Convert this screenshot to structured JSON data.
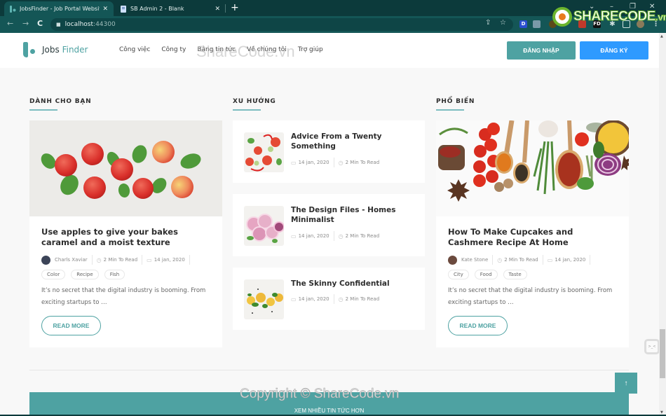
{
  "browser": {
    "tabs": [
      {
        "title": "JobsFinder - Job Portal Website T",
        "active": true,
        "icon": "jobsfinder-favicon"
      },
      {
        "title": "SB Admin 2 - Blank",
        "active": false,
        "icon": "document-favicon"
      }
    ],
    "new_tab": "+",
    "close": "✕",
    "url_host": "localhost",
    "url_port": ":44300",
    "window_controls": {
      "dropdown": "⌄",
      "minimize": "–",
      "maximize": "❐",
      "close": "✕"
    },
    "nav": {
      "back": "←",
      "forward": "→",
      "reload": "C"
    },
    "omnibox_icons": {
      "share": "⇪",
      "star": "☆"
    },
    "extensions": [
      "D",
      "",
      "",
      "",
      "FD",
      "",
      "",
      ""
    ],
    "menu": "⋮"
  },
  "watermark": {
    "brand": "SHARECODE",
    "tld": ".vn",
    "header_text": "ShareCode.vn",
    "copyright": "Copyright © ShareCode.vn"
  },
  "header": {
    "logo_text_1": "Jobs",
    "logo_text_2": "Finder",
    "nav": [
      "Công việc",
      "Công ty",
      "Bảng tin tức",
      "Về chúng tôi",
      "Trợ giúp"
    ],
    "login_label": "ĐĂNG NHẬP",
    "register_label": "ĐĂNG KÝ"
  },
  "sections": {
    "for_you": {
      "title": "DÀNH CHO BẠN",
      "card": {
        "image": "apples-image",
        "title": "Use apples to give your bakes caramel and a moist texture",
        "author": "Charls Xaviar",
        "read_time": "2 Min To Read",
        "date": "14 jan, 2020",
        "tags": [
          "Color",
          "Recipe",
          "Fish"
        ],
        "excerpt": "It’s no secret that the digital industry is booming. From exciting startups to …",
        "read_more": "READ MORE"
      }
    },
    "trending": {
      "title": "XU HƯỚNG",
      "items": [
        {
          "image": "tomato-salad-thumbnail",
          "title": "Advice From a Twenty Something",
          "date": "14 jan, 2020",
          "read_time": "2 Min To Read"
        },
        {
          "image": "onion-slices-thumbnail",
          "title": "The Design Files - Homes Minimalist",
          "date": "14 jan, 2020",
          "read_time": "2 Min To Read"
        },
        {
          "image": "pasta-basil-thumbnail",
          "title": "The Skinny Confidential",
          "date": "14 jan, 2020",
          "read_time": "2 Min To Read"
        }
      ]
    },
    "popular": {
      "title": "PHỔ BIẾN",
      "card": {
        "image": "spices-image",
        "title": "How To Make Cupcakes and Cashmere Recipe At Home",
        "author": "Kate Stone",
        "read_time": "2 Min To Read",
        "date": "14 jan, 2020",
        "tags": [
          "City",
          "Food",
          "Taste"
        ],
        "excerpt": "It’s no secret that the digital industry is booming. From exciting startups to …",
        "read_more": "READ MORE"
      }
    }
  },
  "more_news_label": "XEM NHIỀU TIN TỨC HƠN",
  "scroll_top": "↑",
  "chat_widget": ">_<",
  "icons": {
    "clock": "◷",
    "calendar": "▭"
  },
  "colors": {
    "accent": "#4ea2a2",
    "primary": "#2e9aff",
    "chrome_dark": "#0c3a3b",
    "chrome_mid": "#145656"
  }
}
